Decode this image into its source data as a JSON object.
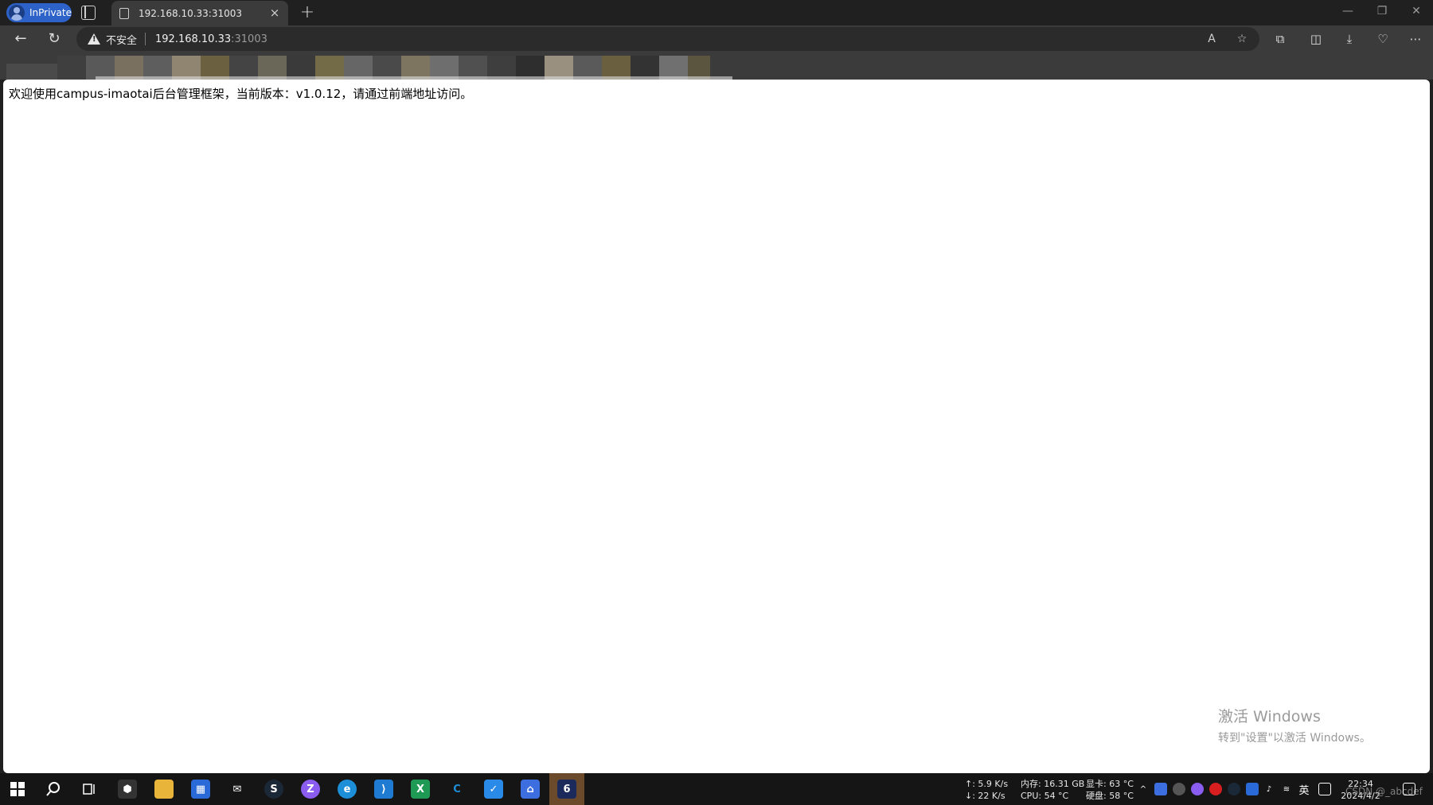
{
  "browser": {
    "inprivate_label": "InPrivate",
    "tab_title": "192.168.10.33:31003",
    "tab_close": "×",
    "new_tab": "+",
    "security_label": "不安全",
    "url_host": "192.168.10.33",
    "url_port": ":31003",
    "window_controls": [
      "—",
      "❐",
      "✕"
    ]
  },
  "page": {
    "welcome_text": "欢迎使用campus-imaotai后台管理框架，当前版本：v1.0.12，请通过前端地址访问。"
  },
  "watermark": {
    "line1": "激活 Windows",
    "line2": "转到\"设置\"以激活 Windows。"
  },
  "taskbar": {
    "net_up": "↑: 5.9 K/s",
    "net_down": "↓: 22 K/s",
    "mem": "内存: 16.31 GB",
    "gpu": "显卡: 63 °C",
    "cpu": "CPU: 54 °C",
    "disk": "硬盘: 58 °C",
    "ime": "英",
    "time": "22:34",
    "date": "2024/4/2",
    "watermark_csdn": "CSDN @_abcdef"
  },
  "colors": {
    "accent": "#2d63c8",
    "tab_active": "#3b3b3b",
    "chrome_bg": "#202020",
    "taskbar_bg": "#151515"
  }
}
